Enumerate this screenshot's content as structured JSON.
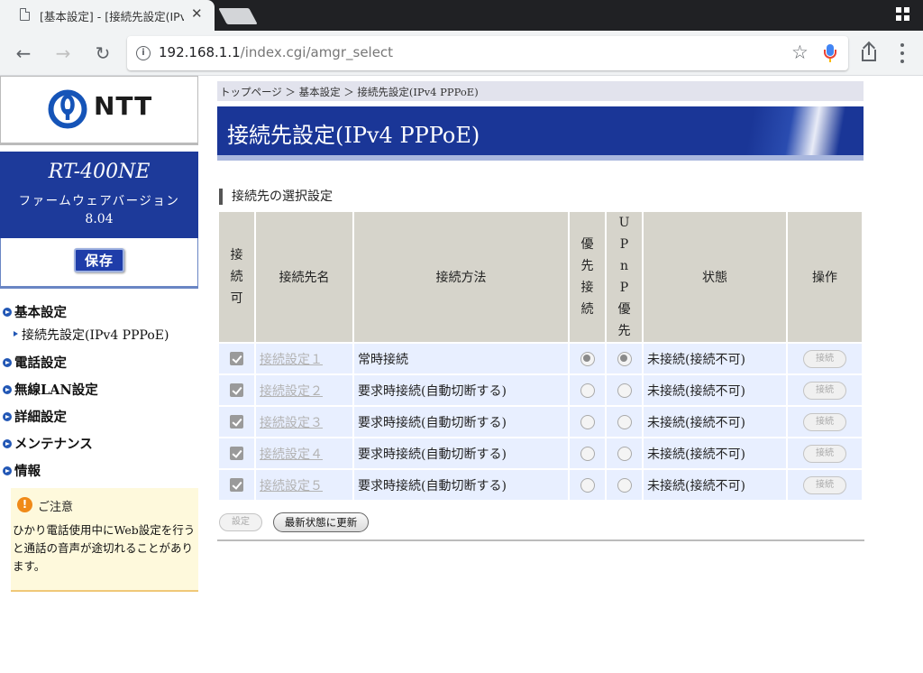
{
  "browser": {
    "tab_title": "[基本設定] - [接続先設定(IPv",
    "tab_close": "✕",
    "url_host": "192.168.1.1",
    "url_path": "/index.cgi/amgr_select",
    "nav_back": "←",
    "nav_forward": "→",
    "nav_reload": "↻",
    "star": "☆"
  },
  "sidebar": {
    "logo_text": "NTT",
    "model": "RT-400NE",
    "firmware_label": "ファームウェアバージョン",
    "firmware_version": "8.04",
    "save_label": "保存",
    "nav": [
      {
        "label": "基本設定"
      },
      {
        "label": "接続先設定(IPv4 PPPoE)"
      },
      {
        "label": "電話設定"
      },
      {
        "label": "無線LAN設定"
      },
      {
        "label": "詳細設定"
      },
      {
        "label": "メンテナンス"
      },
      {
        "label": "情報"
      }
    ],
    "notice": {
      "title": "ご注意",
      "body": "ひかり電話使用中にWeb設定を行うと通話の音声が途切れることがあります。"
    }
  },
  "main": {
    "breadcrumb": "トップページ ＞ 基本設定 ＞ 接続先設定(IPv4 PPPoE)",
    "page_title": "接続先設定(IPv4 PPPoE)",
    "section_title": "接続先の選択設定",
    "table": {
      "headers": {
        "enable": [
          "接",
          "続",
          "可"
        ],
        "name": "接続先名",
        "method": "接続方法",
        "priority": [
          "優",
          "先",
          "接",
          "続"
        ],
        "upnp": [
          "U",
          "P",
          "n",
          "P",
          "優",
          "先"
        ],
        "state": "状態",
        "operation": "操作"
      },
      "rows": [
        {
          "enabled": true,
          "name": "接続設定１",
          "method": "常時接続",
          "priority": true,
          "upnp": true,
          "state": "未接続(接続不可)",
          "op": "接続"
        },
        {
          "enabled": true,
          "name": "接続設定２",
          "method": "要求時接続(自動切断する)",
          "priority": false,
          "upnp": false,
          "state": "未接続(接続不可)",
          "op": "接続"
        },
        {
          "enabled": true,
          "name": "接続設定３",
          "method": "要求時接続(自動切断する)",
          "priority": false,
          "upnp": false,
          "state": "未接続(接続不可)",
          "op": "接続"
        },
        {
          "enabled": true,
          "name": "接続設定４",
          "method": "要求時接続(自動切断する)",
          "priority": false,
          "upnp": false,
          "state": "未接続(接続不可)",
          "op": "接続"
        },
        {
          "enabled": true,
          "name": "接続設定５",
          "method": "要求時接続(自動切断する)",
          "priority": false,
          "upnp": false,
          "state": "未接続(接続不可)",
          "op": "接続"
        }
      ]
    },
    "set_button": "設定",
    "refresh_button": "最新状態に更新"
  },
  "colors": {
    "brand_blue": "#1d3a9a",
    "header_gray": "#d6d4cb",
    "row_blue": "#e8efff",
    "notice_bg": "#fef9dc"
  }
}
